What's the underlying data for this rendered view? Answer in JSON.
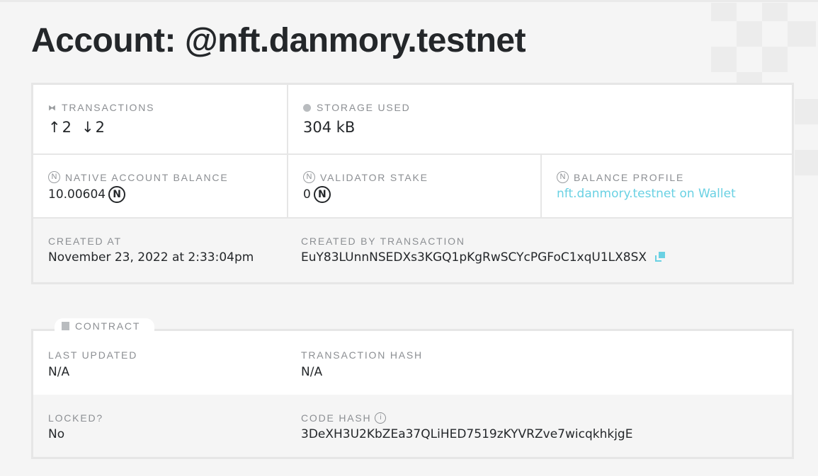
{
  "page": {
    "title": "Account: @nft.danmory.testnet"
  },
  "account": {
    "transactions": {
      "label": "TRANSACTIONS",
      "sent": "2",
      "received": "2"
    },
    "storage": {
      "label": "STORAGE USED",
      "value": "304 kB"
    },
    "native_balance": {
      "label": "NATIVE ACCOUNT BALANCE",
      "value": "10.00604"
    },
    "validator_stake": {
      "label": "VALIDATOR STAKE",
      "value": "0"
    },
    "balance_profile": {
      "label": "BALANCE PROFILE",
      "link_text": "nft.danmory.testnet on Wallet"
    },
    "created_at": {
      "label": "CREATED AT",
      "value": "November 23, 2022 at 2:33:04pm"
    },
    "created_by": {
      "label": "CREATED BY TRANSACTION",
      "value": "EuY83LUnnNSEDXs3KGQ1pKgRwSCYcPGFoC1xqU1LX8SX"
    }
  },
  "contract": {
    "title": "CONTRACT",
    "last_updated": {
      "label": "LAST UPDATED",
      "value": "N/A"
    },
    "transaction_hash": {
      "label": "TRANSACTION HASH",
      "value": "N/A"
    },
    "locked": {
      "label": "LOCKED?",
      "value": "No"
    },
    "code_hash": {
      "label": "CODE HASH",
      "value": "3DeXH3U2KbZEa37QLiHED7519zKYVRZve7wicqkhkjgE"
    }
  },
  "icons": {
    "near": "N",
    "arrow_up": "↑",
    "arrow_down": "↓",
    "info": "i"
  },
  "colors": {
    "link": "#6ad1e3",
    "text": "#24272a",
    "label": "#8c8f93"
  }
}
